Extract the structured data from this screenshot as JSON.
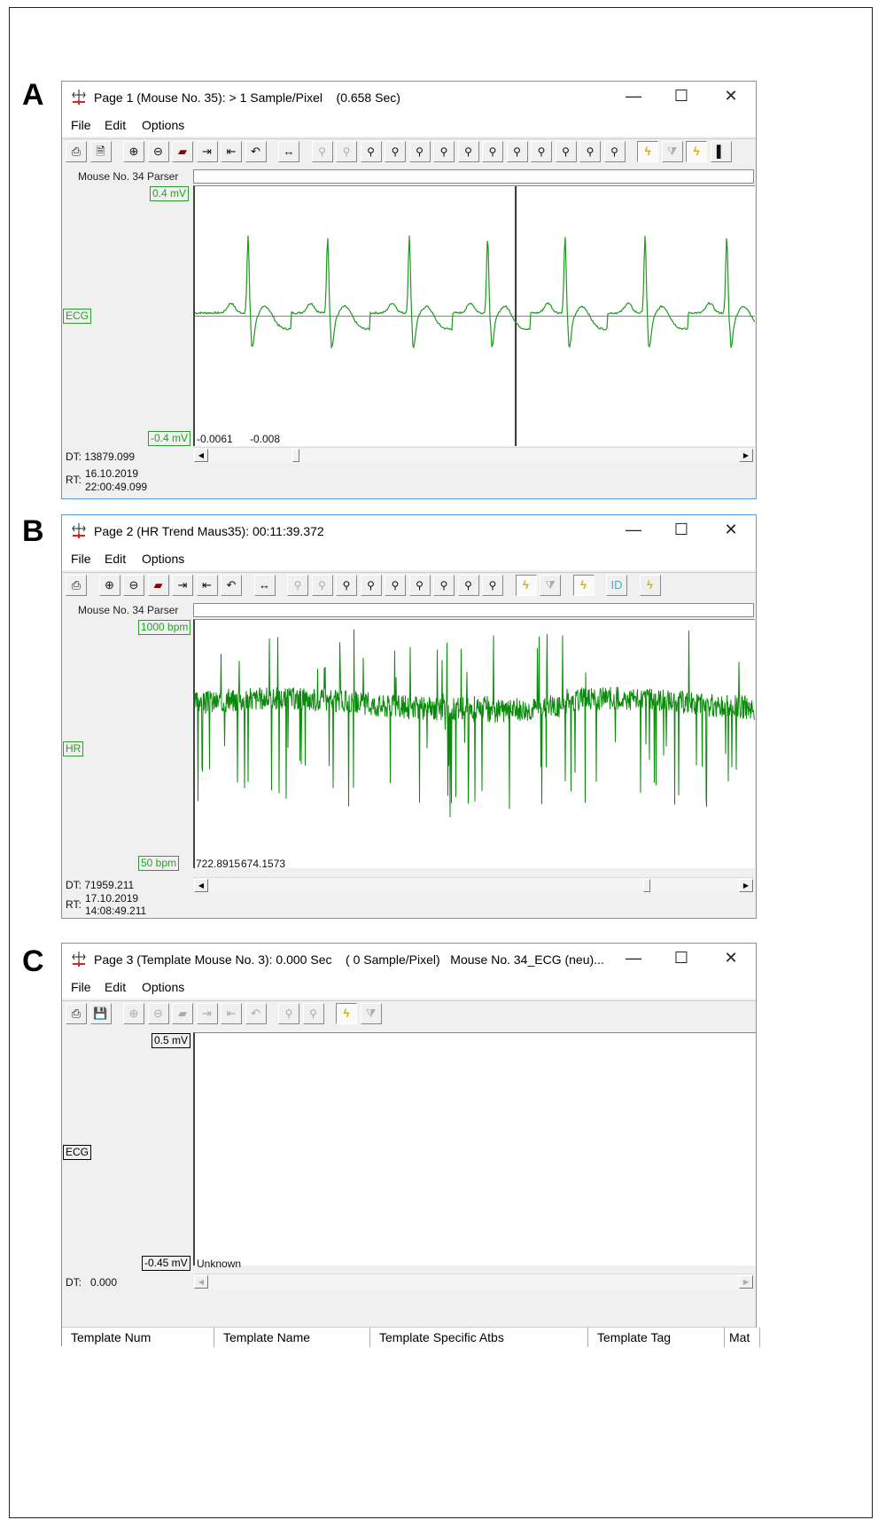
{
  "figure_labels": [
    "A",
    "B",
    "C"
  ],
  "window_a": {
    "title": "Page 1 (Mouse No. 35): > 1 Sample/Pixel    (0.658 Sec)",
    "menu": [
      "File",
      "Edit",
      "Options"
    ],
    "toolbar_groups": [
      [
        "printer-icon",
        "document-icon"
      ],
      [
        "zoom-in-icon",
        "zoom-out-icon",
        "fit-wave-icon",
        "expand-icon",
        "compress-icon",
        "undo-icon"
      ],
      [
        "horizontal-arrows-icon"
      ],
      [
        "find-prev-icon",
        "find-next-icon",
        "mail-find-icon",
        "mail-find2-icon",
        "find-marker-icon",
        "find-marker2-icon",
        "find-flag-icon",
        "find-flag2-icon",
        "find-clock-icon",
        "find-red-icon",
        "find-red2-icon",
        "find-teal-icon",
        "find-teal2-icon"
      ],
      [
        "lightning-icon",
        "filter-icon",
        "lightning-toggle-icon",
        "more-icon"
      ]
    ],
    "parser_label": "Mouse No. 34 Parser",
    "y_top": "0.4 mV",
    "y_bottom": "-0.4 mV",
    "channel": "ECG",
    "readout1": "-0.0061",
    "readout2": "-0.008",
    "dt": "DT: 13879.099",
    "rt_label": "RT:",
    "rt_date": "16.10.2019",
    "rt_time": "22:00:49.099"
  },
  "window_b": {
    "title": "Page 2 (HR Trend Maus35): 00:11:39.372",
    "menu": [
      "File",
      "Edit",
      "Options"
    ],
    "toolbar_groups": [
      [
        "printer-icon"
      ],
      [
        "zoom-in-icon",
        "zoom-out-icon",
        "fit-wave-icon",
        "expand-icon",
        "compress-icon",
        "undo-icon"
      ],
      [
        "horizontal-arrows-icon"
      ],
      [
        "find-prev-icon",
        "find-next-icon",
        "mail-find-icon",
        "mail-find2-icon",
        "find-marker-icon",
        "find-marker2-icon",
        "find-flag-icon",
        "find-flag2-icon",
        "find-clock-icon"
      ],
      [
        "lightning-icon",
        "filter-icon"
      ],
      [
        "lightning-toggle-icon"
      ],
      [
        "id-icon"
      ],
      [
        "lightning2-icon"
      ]
    ],
    "parser_label": "Mouse No. 34 Parser",
    "y_top": "1000 bpm",
    "y_bottom": "50 bpm",
    "channel": "HR",
    "readout1": "722.8915",
    "readout2": "674.1573",
    "dt": "DT: 71959.211",
    "rt_label": "RT:",
    "rt_date": "17.10.2019",
    "rt_time": "14:08:49.211"
  },
  "window_c": {
    "title": "Page 3 (Template Mouse No. 3): 0.000 Sec    ( 0 Sample/Pixel)   Mouse No. 34_ECG (neu)...",
    "menu": [
      "File",
      "Edit",
      "Options"
    ],
    "toolbar_groups": [
      [
        "printer-icon",
        "save-icon"
      ],
      [
        "zoom-in-icon",
        "zoom-out-icon",
        "fit-wave-icon",
        "expand-icon",
        "compress-icon",
        "undo-icon"
      ],
      [
        "find-prev-icon",
        "find-next-icon"
      ],
      [
        "lightning-icon",
        "filter-icon"
      ]
    ],
    "y_top": "0.5 mV",
    "y_bottom": "-0.45 mV",
    "channel": "ECG",
    "readout1": "Unknown",
    "dt": "DT:   0.000",
    "columns": [
      "Template Num",
      "Template Name",
      "Template Specific Atbs",
      "Template Tag",
      "Mat"
    ]
  },
  "window_controls": {
    "minimize": "—",
    "maximize": "☐",
    "close": "✕"
  },
  "chart_data": [
    {
      "type": "line",
      "title": "ECG",
      "ylabel": "mV",
      "ylim": [
        -0.4,
        0.4
      ],
      "xlim_sec": [
        0,
        0.658
      ],
      "beat_times_sec": [
        0.0625,
        0.156,
        0.252,
        0.344,
        0.435,
        0.529,
        0.625
      ],
      "r_peak_mV": 0.24,
      "cursor_sec": 0.377,
      "color": "#1e9a1e"
    },
    {
      "type": "line",
      "title": "HR",
      "ylabel": "bpm",
      "ylim": [
        50,
        1000
      ],
      "mean_bpm": 680,
      "color": "#0a8a0a"
    },
    {
      "type": "line",
      "title": "ECG template",
      "ylabel": "mV",
      "ylim": [
        -0.45,
        0.5
      ]
    }
  ]
}
